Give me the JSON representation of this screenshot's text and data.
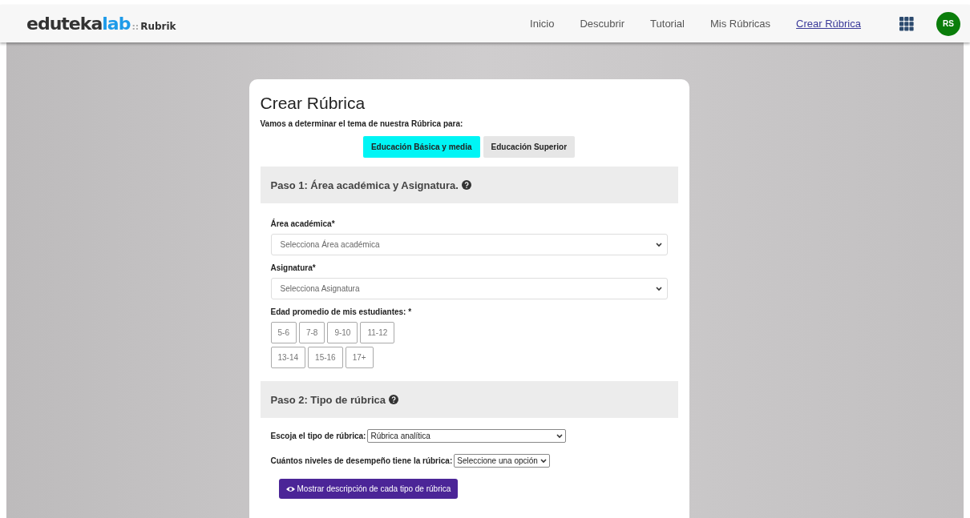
{
  "logo": {
    "brand": "eduteka",
    "accent": "lab",
    "separator": "::",
    "product": "Rubrik"
  },
  "nav": [
    {
      "label": "Inicio",
      "selected": false
    },
    {
      "label": "Descubrir",
      "selected": false
    },
    {
      "label": "Tutorial",
      "selected": false
    },
    {
      "label": "Mis Rúbricas",
      "selected": false
    },
    {
      "label": "Crear Rúbrica",
      "selected": true
    }
  ],
  "avatar": "RS",
  "card": {
    "title": "Crear Rúbrica",
    "intro": "Vamos a determinar el tema de nuestra Rúbrica para:",
    "levels": [
      {
        "label": "Educación Básica y media",
        "selected": true
      },
      {
        "label": "Educación Superior",
        "selected": false
      }
    ],
    "step1": {
      "heading": "Paso 1: Área académica y Asignatura.",
      "fields": [
        {
          "label": "Área académica*",
          "placeholder": "Selecciona Área académica"
        },
        {
          "label": "Asignatura*",
          "placeholder": "Selecciona Asignatura"
        }
      ],
      "age_label": "Edad promedio de mis estudiantes: *",
      "age_rows": [
        [
          {
            "label": "5-6",
            "selected": false
          },
          {
            "label": "7-8",
            "selected": false
          },
          {
            "label": "9-10",
            "selected": false
          },
          {
            "label": "11-12",
            "selected": false
          }
        ],
        [
          {
            "label": "13-14",
            "selected": false
          },
          {
            "label": "15-16",
            "selected": false
          },
          {
            "label": "17+",
            "selected": false
          }
        ]
      ]
    },
    "step2": {
      "heading": "Paso 2: Tipo de rúbrica",
      "selects": [
        {
          "label": "Escoja el tipo de rúbrica:",
          "value": "Rúbrica analítica",
          "kind": "wide"
        },
        {
          "label": "Cuántos niveles de desempeño tiene la rúbrica:",
          "value": "Seleccione una opción",
          "kind": "compact"
        }
      ],
      "button": "Mostrar descripción de cada tipo de rúbrica"
    }
  }
}
